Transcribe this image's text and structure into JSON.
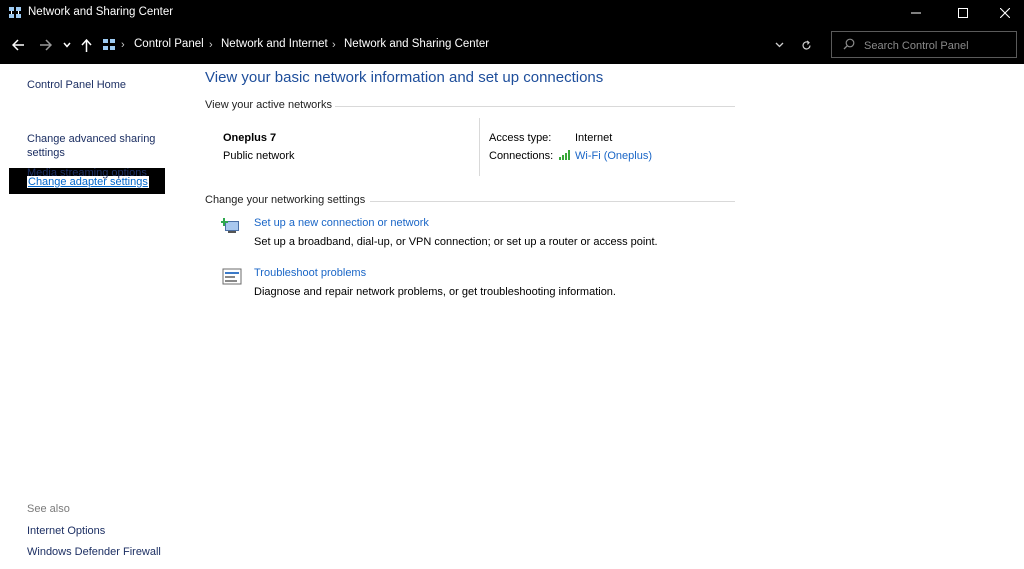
{
  "window": {
    "title": "Network and Sharing Center",
    "controls": {
      "minimize": "minimize-icon",
      "maximize": "maximize-icon",
      "close": "close-icon"
    }
  },
  "address": {
    "breadcrumbs": [
      "Control Panel",
      "Network and Internet",
      "Network and Sharing Center"
    ],
    "search_placeholder": "Search Control Panel"
  },
  "left_pane": {
    "home": "Control Panel Home",
    "links": [
      "Change adapter settings",
      "Change advanced sharing settings",
      "Media streaming options"
    ],
    "see_also_label": "See also",
    "see_also": [
      "Internet Options",
      "Windows Defender Firewall"
    ]
  },
  "main": {
    "title": "View your basic network information and set up connections",
    "active_networks_label": "View your active networks",
    "network": {
      "name": "Oneplus 7",
      "type": "Public network",
      "access_type_label": "Access type:",
      "access_type_value": "Internet",
      "connections_label": "Connections:",
      "connection_value": "Wi-Fi (Oneplus)"
    },
    "change_settings_label": "Change your networking settings",
    "tasks": [
      {
        "link": "Set up a new connection or network",
        "desc": "Set up a broadband, dial-up, or VPN connection; or set up a router or access point.",
        "icon": "new-connection-icon"
      },
      {
        "link": "Troubleshoot problems",
        "desc": "Diagnose and repair network problems, or get troubleshooting information.",
        "icon": "troubleshoot-icon"
      }
    ]
  },
  "colors": {
    "titlebar": "#000000",
    "link": "#1a66c7",
    "heading": "#1e4e9b",
    "wifi_signal": "#3aa83a"
  }
}
